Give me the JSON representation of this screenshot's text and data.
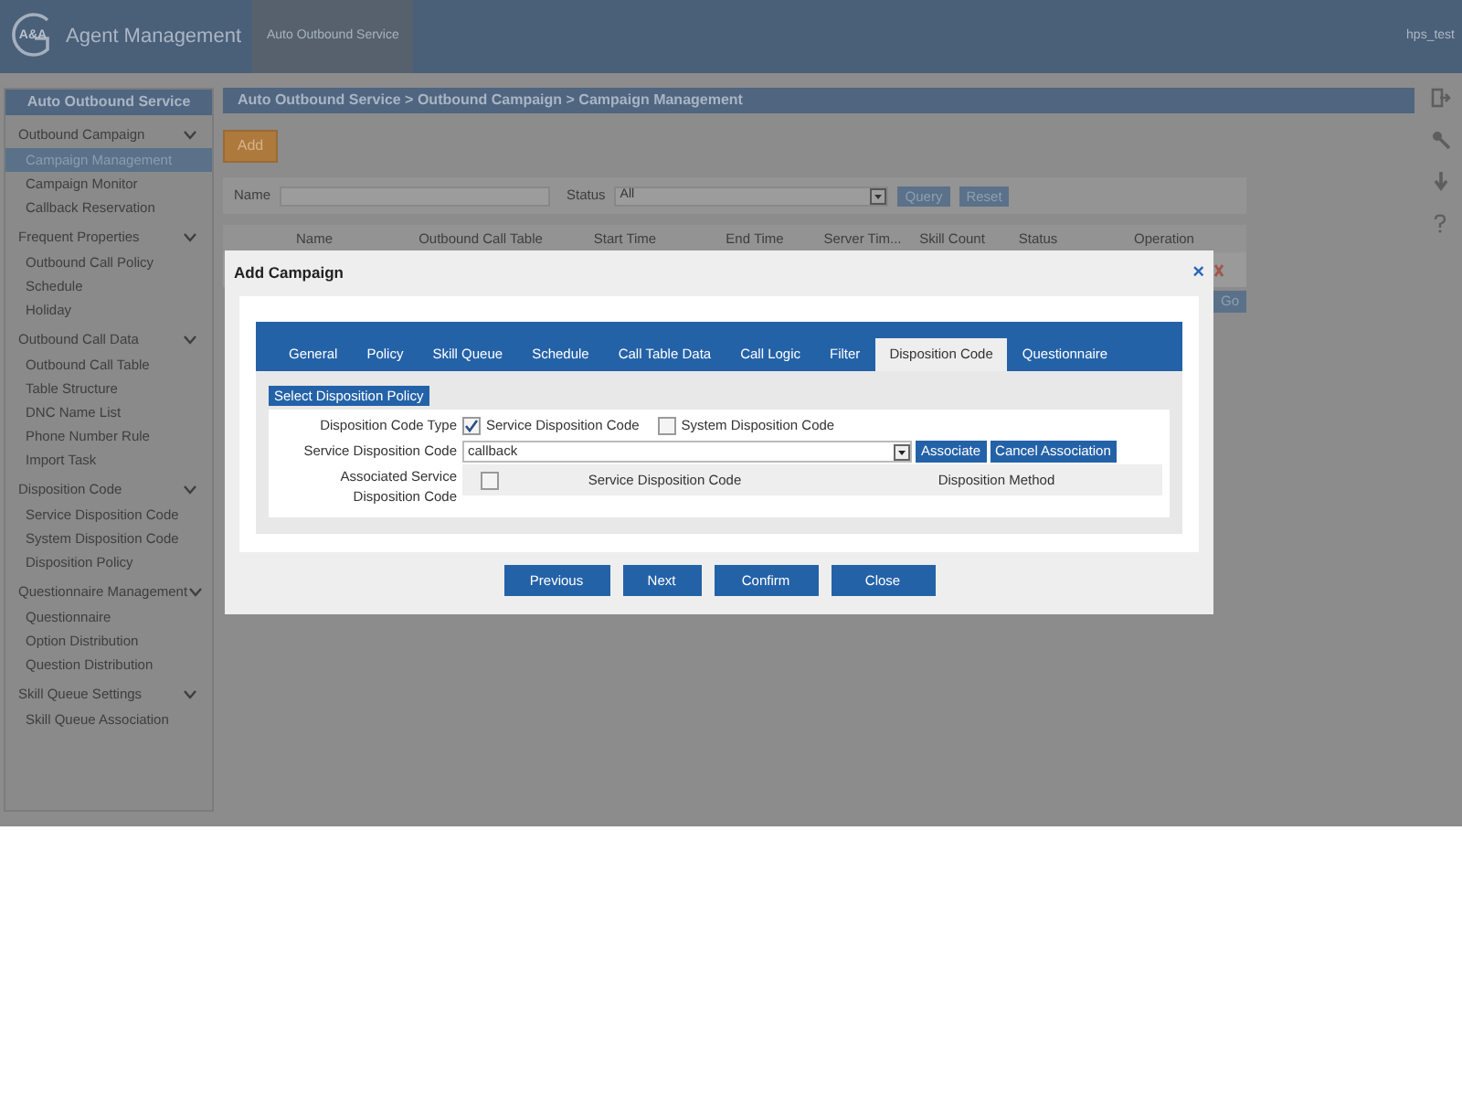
{
  "header": {
    "logo_mark": "A&A",
    "app_title": "Agent Management",
    "nav_tab": {
      "label": "Auto Outbound Service",
      "selected": true
    },
    "user": "hps_test"
  },
  "sidebar": {
    "title": "Auto Outbound Service",
    "groups": [
      {
        "label": "Outbound Campaign",
        "expanded": true,
        "items": [
          {
            "label": "Campaign Management",
            "selected": true
          },
          {
            "label": "Campaign Monitor",
            "selected": false
          },
          {
            "label": "Callback Reservation",
            "selected": false
          }
        ]
      },
      {
        "label": "Frequent Properties",
        "expanded": true,
        "items": [
          {
            "label": "Outbound Call Policy",
            "selected": false
          },
          {
            "label": "Schedule",
            "selected": false
          },
          {
            "label": "Holiday",
            "selected": false
          }
        ]
      },
      {
        "label": "Outbound Call Data",
        "expanded": true,
        "items": [
          {
            "label": "Outbound Call Table",
            "selected": false
          },
          {
            "label": "Table Structure",
            "selected": false
          },
          {
            "label": "DNC Name List",
            "selected": false
          },
          {
            "label": "Phone Number Rule",
            "selected": false
          },
          {
            "label": "Import Task",
            "selected": false
          }
        ]
      },
      {
        "label": "Disposition Code",
        "expanded": true,
        "items": [
          {
            "label": "Service Disposition Code",
            "selected": false
          },
          {
            "label": "System Disposition Code",
            "selected": false
          },
          {
            "label": "Disposition Policy",
            "selected": false
          }
        ]
      },
      {
        "label": "Questionnaire Management",
        "expanded": true,
        "items": [
          {
            "label": "Questionnaire",
            "selected": false
          },
          {
            "label": "Option Distribution",
            "selected": false
          },
          {
            "label": "Question Distribution",
            "selected": false
          }
        ]
      },
      {
        "label": "Skill Queue Settings",
        "expanded": true,
        "items": [
          {
            "label": "Skill Queue Association",
            "selected": false
          }
        ]
      }
    ]
  },
  "breadcrumb": "Auto Outbound Service > Outbound Campaign > Campaign Management",
  "add_button": "Add",
  "filter": {
    "name_label": "Name",
    "status_label": "Status",
    "status_value": "All",
    "buttons": [
      "Query",
      "Reset"
    ]
  },
  "table": {
    "columns": [
      "Name",
      "Outbound Call Table",
      "Start Time",
      "End Time",
      "Server Tim...",
      "Skill Count",
      "Status",
      "Operation"
    ]
  },
  "pager_button": "Go",
  "modal": {
    "title": "Add Campaign",
    "close": "×",
    "tabs": [
      {
        "label": "General",
        "selected": false
      },
      {
        "label": "Policy",
        "selected": false
      },
      {
        "label": "Skill Queue",
        "selected": false
      },
      {
        "label": "Schedule",
        "selected": false
      },
      {
        "label": "Call Table Data",
        "selected": false
      },
      {
        "label": "Call Logic",
        "selected": false
      },
      {
        "label": "Filter",
        "selected": false
      },
      {
        "label": "Disposition Code",
        "selected": true
      },
      {
        "label": "Questionnaire",
        "selected": false
      }
    ],
    "select_policy_button": "Select Disposition Policy",
    "type_label": "Disposition Code Type",
    "type_options": [
      {
        "label": "Service Disposition Code",
        "checked": true
      },
      {
        "label": "System Disposition Code",
        "checked": false
      }
    ],
    "code_label": "Service Disposition Code",
    "code_value": "callback",
    "code_buttons": [
      "Associate",
      "Cancel Association"
    ],
    "assoc_label": "Associated Service Disposition Code",
    "assoc_table": {
      "select_all_checked": false,
      "columns": [
        "Service Disposition Code",
        "Disposition Method"
      ]
    },
    "footer_buttons": [
      "Previous",
      "Next",
      "Confirm",
      "Close"
    ]
  }
}
